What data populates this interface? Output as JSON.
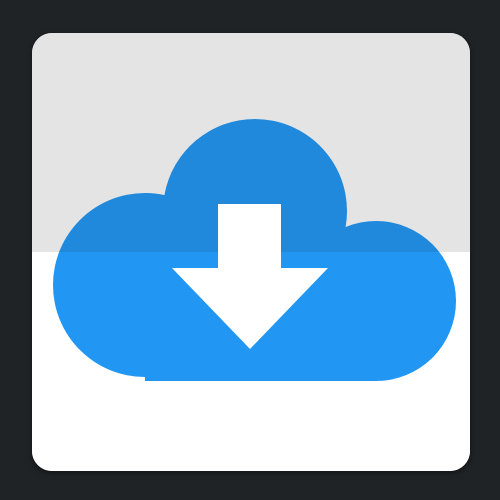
{
  "app_icon": {
    "icon": "cloud-download-icon",
    "colors": {
      "background": "#1f2326",
      "tile_top": "#e4e4e4",
      "tile_bottom": "#ffffff",
      "cloud_upper": "#2089dc",
      "cloud_lower": "#2196f3",
      "arrow": "#ffffff"
    }
  }
}
